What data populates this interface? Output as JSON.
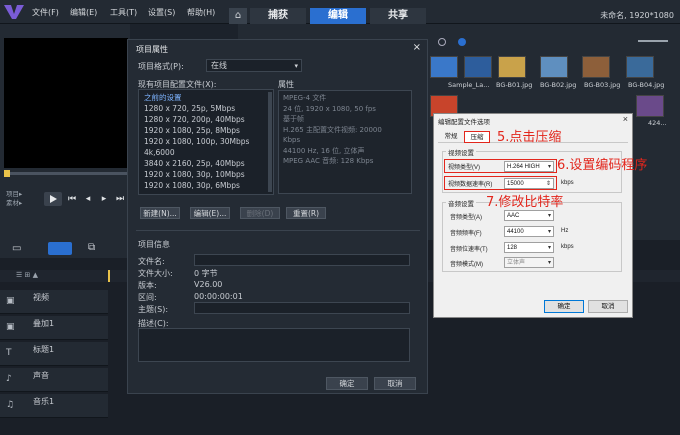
{
  "menubar": {
    "items": [
      "文件(F)",
      "编辑(E)",
      "工具(T)",
      "设置(S)",
      "帮助(H)"
    ],
    "home_icon": "home-icon",
    "tabs": [
      "捕获",
      "编辑",
      "共享"
    ],
    "active_tab": "编辑",
    "project_title": "未命名, 1920*1080"
  },
  "preview": {
    "labels": [
      "项目▸",
      "素材▸"
    ]
  },
  "library": {
    "thumbnails": [
      {
        "label": "",
        "color": "#3a78c9"
      },
      {
        "label": "",
        "color": "#2d5d9c"
      },
      {
        "label": "",
        "color": "#c9a24a"
      },
      {
        "label": "",
        "color": "#5f8fbf"
      },
      {
        "label": "",
        "color": "#8d5f3a"
      },
      {
        "label": "Sample_La...",
        "color": "#c8442b"
      },
      {
        "label": "BG-B01.jpg",
        "color": "#d9d9d9"
      },
      {
        "label": "BG-B02.jpg",
        "color": "#e8c860"
      },
      {
        "label": "BG-B03.jpg",
        "color": "#8fb0d0"
      },
      {
        "label": "BG-B04.jpg",
        "color": "#e06070"
      }
    ],
    "thumb_extra": "424..."
  },
  "timeline": {
    "tracks": [
      "视频",
      "叠加1",
      "标题1",
      "声音",
      "音乐1"
    ]
  },
  "project_dialog": {
    "title": "项目属性",
    "format_label": "项目格式(P):",
    "format_value": "在线",
    "profiles_label": "现有项目配置文件(X):",
    "properties_label": "属性",
    "profiles": [
      "之前的设置",
      "1280 x 720, 25p, 5Mbps",
      "1280 x 720, 200p, 40Mbps",
      "1920 x 1080, 25p, 8Mbps",
      "1920 x 1080, 100p, 30Mbps",
      "4k,6000",
      "3840 x 2160, 25p, 40Mbps",
      "1920 x 1080, 30p, 10Mbps",
      "1920 x 1080, 30p, 6Mbps"
    ],
    "properties": [
      "MPEG-4 文件",
      "24 位, 1920 x 1080, 50 fps",
      "基于帧",
      "H.265 主配置文件视频: 20000",
      "Kbps",
      "44100 Hz, 16 位, 立体声",
      "MPEG AAC 音频: 128 Kbps"
    ],
    "buttons": [
      "新建(N)...",
      "编辑(E)...",
      "删除(D)",
      "重置(R)"
    ],
    "info_heading": "项目信息",
    "info_labels": [
      "文件名:",
      "文件大小:",
      "版本:",
      "区间:",
      "主题(S):",
      "描述(C):"
    ],
    "info_values": [
      "",
      "0 字节",
      "V26.00",
      "00:00:00:01",
      "",
      ""
    ],
    "ok": "确定",
    "cancel": "取消"
  },
  "encode_dialog": {
    "title": "编辑配置文件选项",
    "tabs": [
      "常规",
      "压缩"
    ],
    "video_group": "视频设置",
    "video_type_label": "视频类型(V)",
    "video_type_value": "H.264 HIGH",
    "bitrate_label": "视频数据速率(R)",
    "bitrate_value": "15000",
    "bitrate_unit": "kbps",
    "audio_group": "音频设置",
    "audio_rows": [
      {
        "label": "音频类型(A)",
        "value": "AAC",
        "unit": ""
      },
      {
        "label": "音频频率(F)",
        "value": "44100",
        "unit": "Hz"
      },
      {
        "label": "音频位速率(T)",
        "value": "128",
        "unit": "kbps"
      },
      {
        "label": "音频模式(M)",
        "value": "立体声",
        "unit": ""
      }
    ],
    "ok": "确定",
    "cancel": "取消"
  },
  "annotations": {
    "step5": "5.点击压缩",
    "step6": "6.设置编码程序",
    "step7": "7.修改比特率"
  }
}
